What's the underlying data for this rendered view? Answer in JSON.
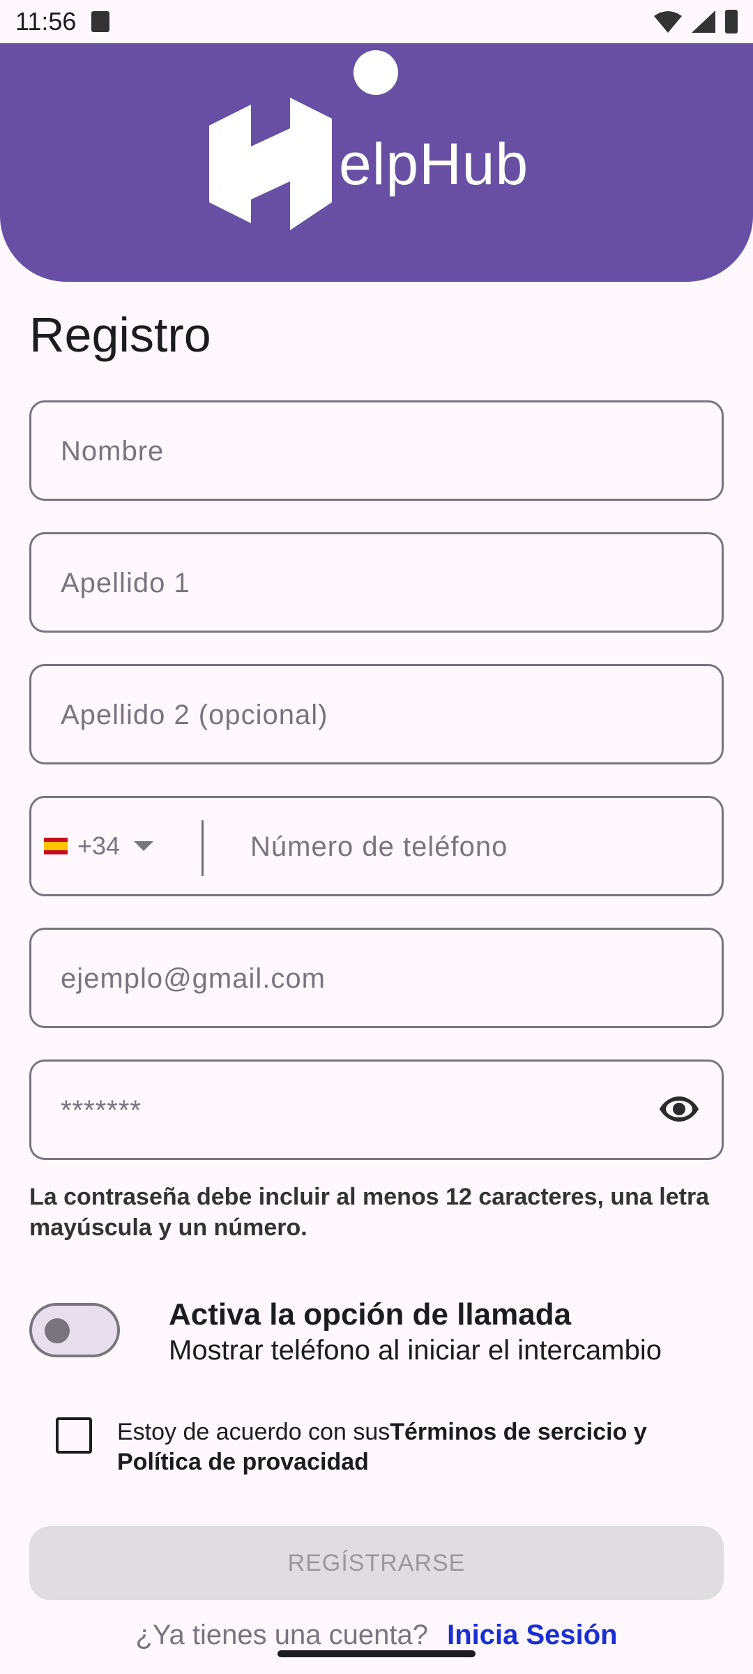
{
  "status_bar": {
    "time": "11:56"
  },
  "app": {
    "logo_text": "elpHub",
    "logo_letter": "H"
  },
  "page": {
    "title": "Registro"
  },
  "form": {
    "first_name_placeholder": "Nombre",
    "last_name1_placeholder": "Apellido 1",
    "last_name2_placeholder": "Apellido 2 (opcional)",
    "phone": {
      "country_code": "+34",
      "placeholder": "Número de teléfono"
    },
    "email_placeholder": "ejemplo@gmail.com",
    "password_placeholder": "*******",
    "password_hint": "La contraseña debe incluir al menos 12 caracteres, una letra mayúscula y un número."
  },
  "call_option": {
    "title": "Activa la opción de llamada",
    "subtitle": "Mostrar teléfono al iniciar el intercambio",
    "enabled": false
  },
  "terms": {
    "prefix": "Estoy de acuerdo con sus",
    "link": "Términos de sercicio y Política de provacidad",
    "checked": false
  },
  "register_button": {
    "label": "REGÍSTRARSE"
  },
  "login": {
    "question": "¿Ya tienes una cuenta?",
    "link": "Inicia Sesión"
  },
  "colors": {
    "primary": "#6750a4",
    "link": "#1a2ed4",
    "outline": "#79747e"
  }
}
